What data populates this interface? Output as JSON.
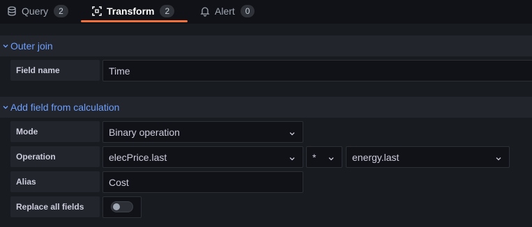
{
  "tabs": [
    {
      "label": "Query",
      "count": "2",
      "icon": "database-icon"
    },
    {
      "label": "Transform",
      "count": "2",
      "icon": "transform-icon"
    },
    {
      "label": "Alert",
      "count": "0",
      "icon": "bell-icon"
    }
  ],
  "outer_join": {
    "title": "Outer join",
    "field_name_label": "Field name",
    "field_name_value": "Time"
  },
  "add_field": {
    "title": "Add field from calculation",
    "mode_label": "Mode",
    "mode_value": "Binary operation",
    "operation_label": "Operation",
    "operation_left": "elecPrice.last",
    "operator": "*",
    "operation_right": "energy.last",
    "alias_label": "Alias",
    "alias_value": "Cost",
    "replace_label": "Replace all fields",
    "replace_enabled": false
  },
  "colors": {
    "accent": "#6e9fff",
    "tab_underline": "#f2703c",
    "background": "#111217",
    "panel": "#181b1f"
  }
}
